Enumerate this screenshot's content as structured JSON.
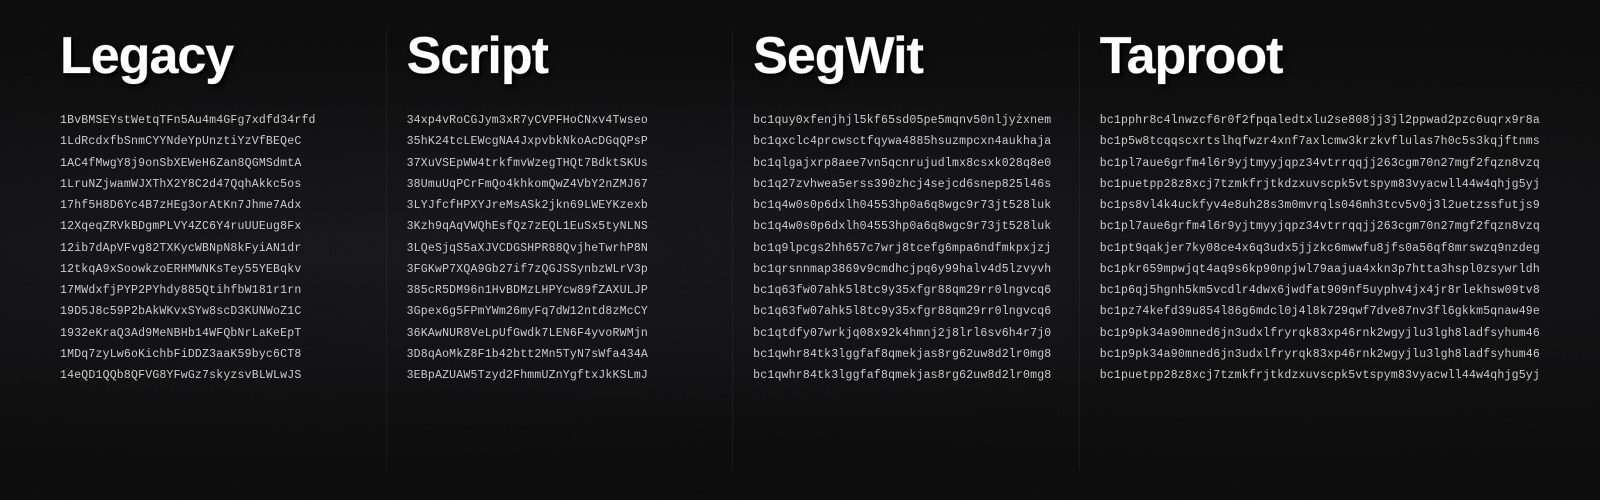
{
  "columns": [
    {
      "id": "legacy",
      "header": "Legacy",
      "addresses": [
        "1BvBMSEYstWetqTFn5Au4m4GFg7xdfd34rfd",
        "1LdRcdxfbSnmCYYNdeYpUnztiYzVfBEQeC",
        "1AC4fMwgY8j9onSbXEWeH6Zan8QGMSdmtA",
        "1LruNZjwamWJXThX2Y8C2d47QqhAkkc5os",
        "17hf5H8D6Yc4B7zHEg3orAtKn7Jhme7Adx",
        "12XqeqZRVkBDgmPLVY4ZC6Y4ruUUEug8Fx",
        "12ib7dApVFvg82TXKycWBNpN8kFyiAN1dr",
        "12tkqA9xSoowkzoERHMWNKsTey55YEBqkv",
        "17MWdxfjPYP2PYhdy885QtihfbW181r1rn",
        "19D5J8c59P2bAkWKvxSYw8scD3KUNWoZ1C",
        "1932eKraQ3Ad9MeNBHb14WFQbNrLaKeEpT",
        "1MDq7zyLw6oKichbFiDDZ3aaK59byc6CT8",
        "14eQD1QQb8QFVG8YFwGz7skyzsvBLWLwJS"
      ]
    },
    {
      "id": "script",
      "header": "Script",
      "addresses": [
        "34xp4vRoCGJym3xR7yCVPFHoCNxv4Twseo",
        "35hK24tcLEWcgNA4JxpvbkNkoAcDGqQPsP",
        "37XuVSEpWW4trkfmvWzegTHQt7BdktSKUs",
        "38UmuUqPCrFmQo4khkomQwZ4VbY2nZMJ67",
        "3LYJfcfHPXYJreMsASk2jkn69LWEYKzexb",
        "3Kzh9qAqVWQhEsfQz7zEQL1EuSx5tyNLNS",
        "3LQeSjqS5aXJVCDGSHPR88QvjheTwrhP8N",
        "3FGKwP7XQA9Gb27if7zQGJSSynbzWLrV3p",
        "385cR5DM96n1HvBDMzLHPYcw89fZAXULJP",
        "3Gpex6g5FPmYWm26myFq7dW12ntd8zMcCY",
        "36KAwNUR8VeLpUfGwdk7LEN6F4yvoRWMjn",
        "3D8qAoMkZ8F1b42btt2Mn5TyN7sWfa434A",
        "3EBpAZUAW5Tzyd2FhmmUZnYgftxJkKSLmJ"
      ]
    },
    {
      "id": "segwit",
      "header": "SegWit",
      "addresses": [
        "bc1quy0xfenjhjl5kf65sd05pe5mqnv50nljyżxnem",
        "bc1qxclc4prcwsctfqywa4885hsuzmpcxn4aukhaja",
        "bc1qlgajxrp8aee7vn5qcnrujudlmx8csxk028q8e0",
        "bc1q27zvhwea5erss390zhcj4sejcd6snep825l46s",
        "bc1q4w0s0p6dxlh04553hp0a6q8wgc9r73jt528luk",
        "bc1q4w0s0p6dxlh04553hp0a6q8wgc9r73jt528luk",
        "bc1q9lpcgs2hh657c7wrj8tcefg6mpa6ndfmkpxjzj",
        "bc1qrsnnmap3869v9cmdhcjpq6y99halv4d5lzvyvh",
        "bc1q63fw07ahk5l8tc9y35xfgr88qm29rr0lngvcq6",
        "bc1q63fw07ahk5l8tc9y35xfgr88qm29rr0lngvcq6",
        "bc1qtdfy07wrkjq08x92k4hmnj2j8lrl6sv6h4r7j0",
        "bc1qwhr84tk3lggfaf8qmekjas8rg62uw8d2lr0mg8",
        "bc1qwhr84tk3lggfaf8qmekjas8rg62uw8d2lr0mg8"
      ]
    },
    {
      "id": "taproot",
      "header": "Taproot",
      "addresses": [
        "bc1pphr8c4lnwzcf6r0f2fpqaledtxlu2se808jj3jl2ppwad2pzc6uqrx9r8a",
        "bc1p5w8tcqqscxrtslhqfwzr4xnf7axlcmw3krzkvflulas7h0c5s3kqjftnms",
        "bc1pl7aue6grfm4l6r9yjtmyyjqpz34vtrrqqjj263cgm70n27mgf2fqzn8vzq",
        "bc1puetpp28z8xcj7tzmkfrjtkdzxuvscpk5vtspym83vyacwll44w4qhjg5yj",
        "bc1ps8vl4k4uckfyv4e8uh28s3m0mvrqls046mh3tcv5v0j3l2uetzssfutjs9",
        "bc1pl7aue6grfm4l6r9yjtmyyjqpz34vtrrqqjj263cgm70n27mgf2fqzn8vzq",
        "bc1pt9qakjer7ky08ce4x6q3udx5jjzkc6mwwfu8jfs0a56qf8mrswzq9nzdeg",
        "bc1pkr659mpwjqt4aq9s6kp90npjwl79aajua4xkn3p7htta3hspl0zsywrldh",
        "bc1p6qj5hgnh5km5vcdlr4dwx6jwdfat909nf5uyphv4jx4jr8rlekhsw09tv8",
        "bc1pz74kefd39u854l86g6mdcl0j4l8k729qwf7dve87nv3fl6gkkm5qnaw49e",
        "bc1p9pk34a90mned6jn3udxlfryrqk83xp46rnk2wgyjlu3lgh8ladfsyhum46",
        "bc1p9pk34a90mned6jn3udxlfryrqk83xp46rnk2wgyjlu3lgh8ladfsyhum46",
        "bc1puetpp28z8xcj7tzmkfrjtkdzxuvscpk5vtspym83vyacwll44w4qhjg5yj"
      ]
    }
  ]
}
